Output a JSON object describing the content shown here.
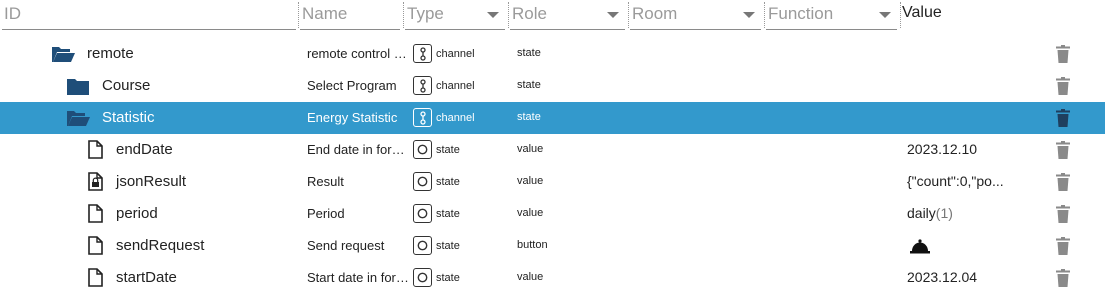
{
  "header": {
    "id_placeholder": "ID",
    "name_placeholder": "Name",
    "type_label": "Type",
    "role_label": "Role",
    "room_label": "Room",
    "function_label": "Function",
    "value_label": "Value"
  },
  "rows": [
    {
      "name": "remote",
      "desc": "remote control Device",
      "type": "channel",
      "role": "state",
      "value": ""
    },
    {
      "name": "Course",
      "desc": "Select Program",
      "type": "channel",
      "role": "state",
      "value": ""
    },
    {
      "name": "Statistic",
      "desc": "Energy Statistic",
      "type": "channel",
      "role": "state",
      "value": ""
    },
    {
      "name": "endDate",
      "desc": "End date in format",
      "type": "state",
      "role": "value",
      "value": "2023.12.10"
    },
    {
      "name": "jsonResult",
      "desc": "Result",
      "type": "state",
      "role": "value",
      "value": "{\"count\":0,\"po..."
    },
    {
      "name": "period",
      "desc": "Period",
      "type": "state",
      "role": "value",
      "value": "daily",
      "value_suffix": "(1)"
    },
    {
      "name": "sendRequest",
      "desc": "Send request",
      "type": "state",
      "role": "button",
      "value": ""
    },
    {
      "name": "startDate",
      "desc": "Start date in format",
      "type": "state",
      "role": "value",
      "value": "2023.12.04"
    }
  ],
  "colors": {
    "selected_row": "#3399cc",
    "folder": "#1f4e79",
    "trash": "#8a8a8a"
  }
}
